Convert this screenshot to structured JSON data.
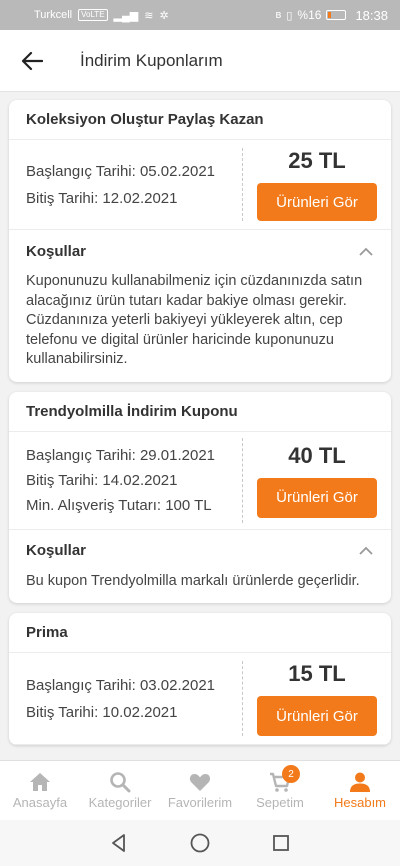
{
  "status_bar": {
    "carrier": "Turkcell",
    "volte": "VoLTE",
    "battery": "%16",
    "time": "18:38"
  },
  "header": {
    "title": "İndirim Kuponlarım"
  },
  "coupons": [
    {
      "title": "Koleksiyon Oluştur Paylaş Kazan",
      "start": "Başlangıç Tarihi: 05.02.2021",
      "end": "Bitiş Tarihi: 12.02.2021",
      "amount": "25 TL",
      "button": "Ürünleri Gör",
      "conditions_label": "Koşullar",
      "conditions_text": "Kuponunuzu kullanabilmeniz için cüzdanınızda satın alacağınız ürün tutarı kadar bakiye olması gerekir. Cüzdanınıza yeterli bakiyeyi yükleyerek altın, cep telefonu ve digital ürünler haricinde kuponunuzu kullanabilirsiniz."
    },
    {
      "title": "Trendyolmilla İndirim Kuponu",
      "start": "Başlangıç Tarihi: 29.01.2021",
      "end": "Bitiş Tarihi: 14.02.2021",
      "min": "Min. Alışveriş Tutarı: 100 TL",
      "amount": "40 TL",
      "button": "Ürünleri Gör",
      "conditions_label": "Koşullar",
      "conditions_text": "Bu kupon Trendyolmilla markalı ürünlerde geçerlidir."
    },
    {
      "title": "Prima",
      "start": "Başlangıç Tarihi: 03.02.2021",
      "end": "Bitiş Tarihi: 10.02.2021",
      "amount": "15 TL",
      "button": "Ürünleri Gör"
    }
  ],
  "bottom_nav": {
    "items": [
      {
        "label": "Anasayfa",
        "icon": "home-icon"
      },
      {
        "label": "Kategoriler",
        "icon": "search-icon"
      },
      {
        "label": "Favorilerim",
        "icon": "heart-icon"
      },
      {
        "label": "Sepetim",
        "icon": "cart-icon",
        "badge": "2"
      },
      {
        "label": "Hesabım",
        "icon": "user-icon",
        "active": true
      }
    ]
  },
  "colors": {
    "accent": "#f27a1a",
    "inactive": "#b5b5b5"
  }
}
